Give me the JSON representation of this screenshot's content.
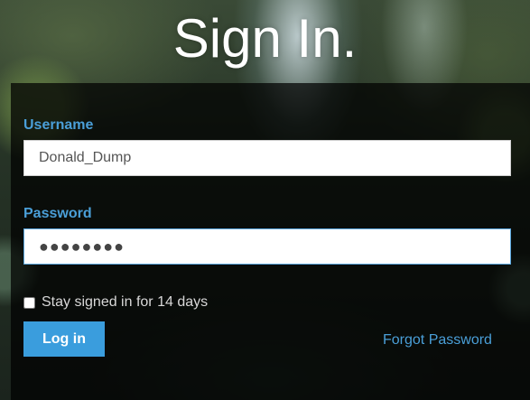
{
  "page": {
    "title": "Sign In."
  },
  "form": {
    "username_label": "Username",
    "username_value": "Donald_Dump",
    "password_label": "Password",
    "password_masked": "●●●●●●●●",
    "remember_label": "Stay signed in for 14 days",
    "remember_checked": false,
    "login_label": "Log in",
    "forgot_label": "Forgot Password"
  },
  "colors": {
    "accent": "#3a9ddd",
    "label_blue": "#4a9fd8",
    "panel_bg": "rgba(0,0,0,0.72)",
    "title_text": "#ffffff"
  }
}
